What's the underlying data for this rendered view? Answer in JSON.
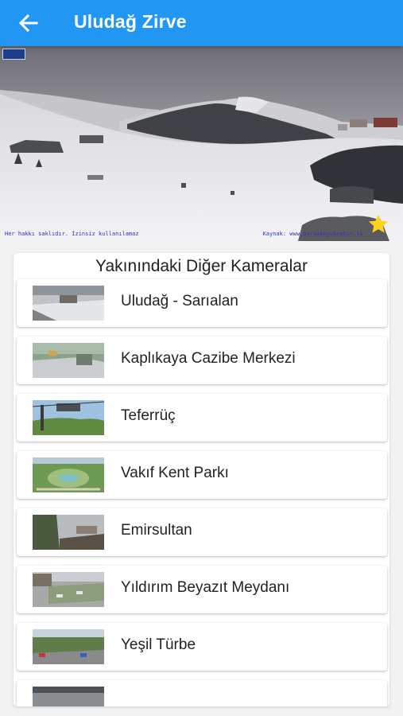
{
  "appbar": {
    "title": "Uludağ Zirve",
    "back_icon": "arrow-back-icon",
    "background": "#2196f3"
  },
  "hero": {
    "overlay_left": "Her hakkı saklıdır. İzinsiz kullanılamaz",
    "overlay_right": "Kaynak: www.bursabuyuksehir.tv",
    "favorite_icon": "star-icon",
    "favorite_color": "#ffd21f"
  },
  "nearby": {
    "title": "Yakınındaki Diğer Kameralar",
    "items": [
      {
        "label": "Uludağ - Sarıalan"
      },
      {
        "label": "Kaplıkaya Cazibe Merkezi"
      },
      {
        "label": "Teferrüç"
      },
      {
        "label": "Vakıf Kent Parkı"
      },
      {
        "label": "Emirsultan"
      },
      {
        "label": "Yıldırım Beyazıt Meydanı"
      },
      {
        "label": "Yeşil Türbe"
      },
      {
        "label": ""
      }
    ]
  }
}
